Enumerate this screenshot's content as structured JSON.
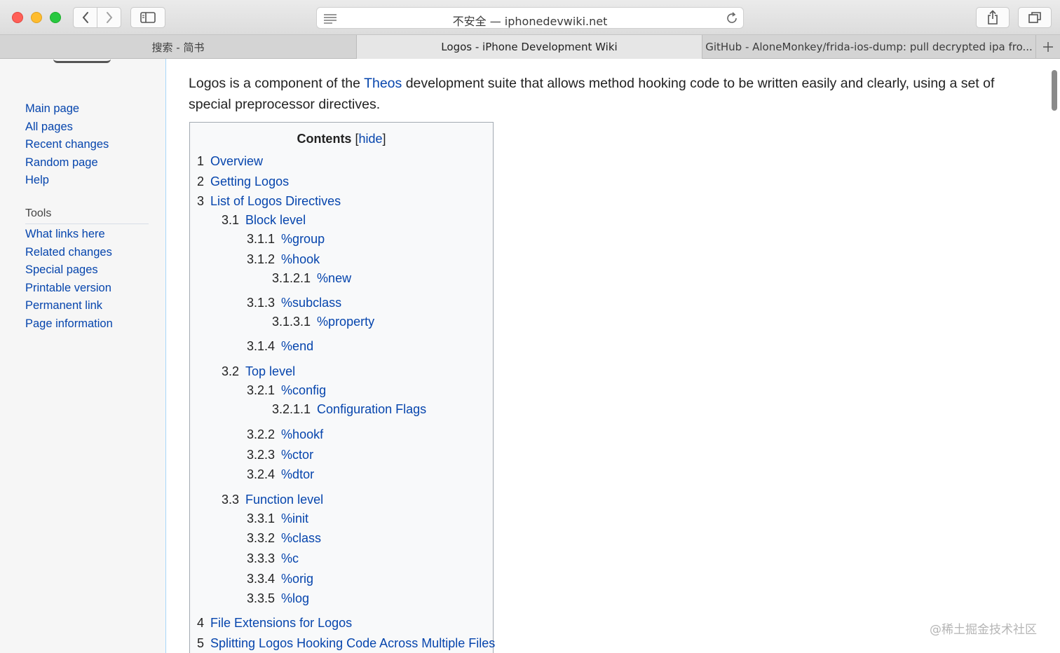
{
  "browser": {
    "address_text": "不安全 — iphonedevwiki.net",
    "tabs": [
      {
        "label": "搜索 - 简书"
      },
      {
        "label": "Logos - iPhone Development Wiki"
      },
      {
        "label": "GitHub - AloneMonkey/frida-ios-dump: pull decrypted ipa fro..."
      }
    ]
  },
  "sidebar": {
    "nav_items": [
      "Main page",
      "All pages",
      "Recent changes",
      "Random page",
      "Help"
    ],
    "tools_heading": "Tools",
    "tools_items": [
      "What links here",
      "Related changes",
      "Special pages",
      "Printable version",
      "Permanent link",
      "Page information"
    ]
  },
  "article": {
    "intro_before": "Logos is a component of the ",
    "intro_link": "Theos",
    "intro_after": " development suite that allows method hooking code to be written easily and clearly, using a set of special preprocessor directives."
  },
  "toc": {
    "title": "Contents",
    "hide_open": "[",
    "hide_label": "hide",
    "hide_close": "]",
    "entries": [
      {
        "num": "1",
        "text": "Overview"
      },
      {
        "num": "2",
        "text": "Getting Logos"
      },
      {
        "num": "3",
        "text": "List of Logos Directives"
      },
      {
        "num": "3.1",
        "text": "Block level"
      },
      {
        "num": "3.1.1",
        "text": "%group"
      },
      {
        "num": "3.1.2",
        "text": "%hook"
      },
      {
        "num": "3.1.2.1",
        "text": "%new"
      },
      {
        "num": "3.1.3",
        "text": "%subclass"
      },
      {
        "num": "3.1.3.1",
        "text": "%property"
      },
      {
        "num": "3.1.4",
        "text": "%end"
      },
      {
        "num": "3.2",
        "text": "Top level"
      },
      {
        "num": "3.2.1",
        "text": "%config"
      },
      {
        "num": "3.2.1.1",
        "text": "Configuration Flags"
      },
      {
        "num": "3.2.2",
        "text": "%hookf"
      },
      {
        "num": "3.2.3",
        "text": "%ctor"
      },
      {
        "num": "3.2.4",
        "text": "%dtor"
      },
      {
        "num": "3.3",
        "text": "Function level"
      },
      {
        "num": "3.3.1",
        "text": "%init"
      },
      {
        "num": "3.3.2",
        "text": "%class"
      },
      {
        "num": "3.3.3",
        "text": "%c"
      },
      {
        "num": "3.3.4",
        "text": "%orig"
      },
      {
        "num": "3.3.5",
        "text": "%log"
      },
      {
        "num": "4",
        "text": "File Extensions for Logos"
      },
      {
        "num": "5",
        "text": "Splitting Logos Hooking Code Across Multiple Files"
      }
    ]
  },
  "watermark": "@稀土掘金技术社区",
  "colors": {
    "link": "#0645ad",
    "text": "#222222",
    "toc_border": "#a2a9b1"
  }
}
